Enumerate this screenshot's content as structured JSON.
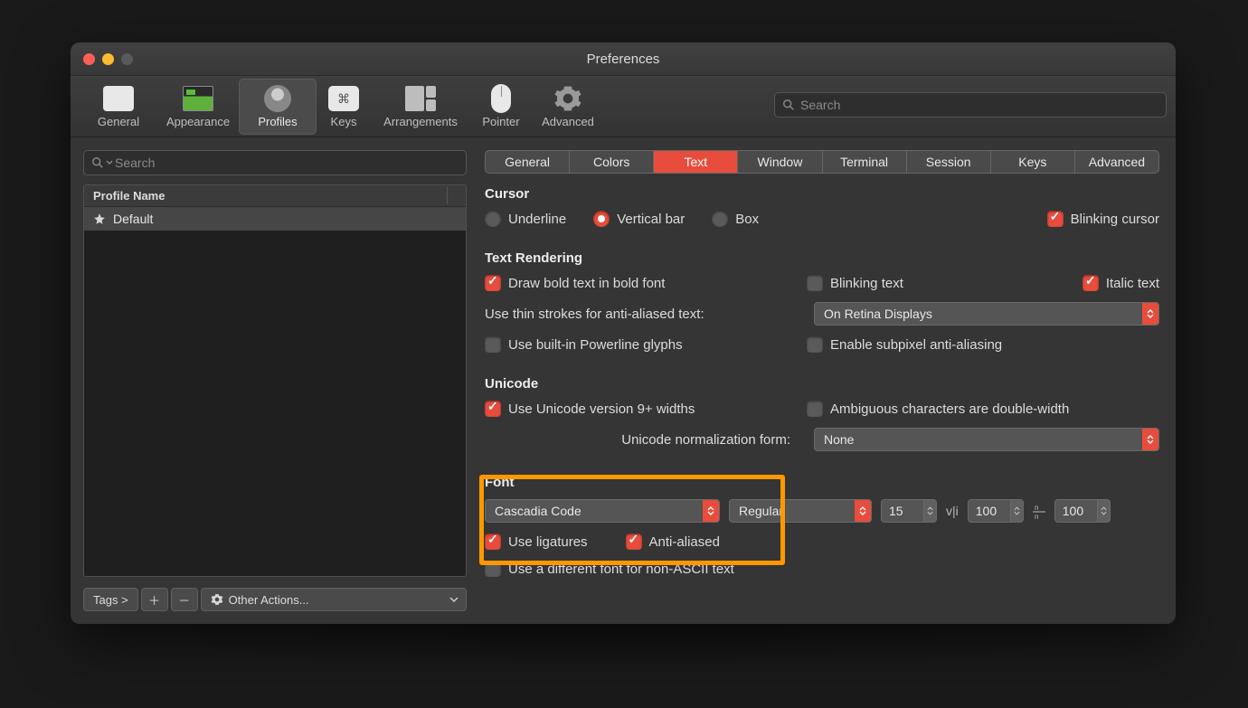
{
  "window": {
    "title": "Preferences"
  },
  "toolbar": {
    "items": [
      {
        "label": "General"
      },
      {
        "label": "Appearance"
      },
      {
        "label": "Profiles"
      },
      {
        "label": "Keys"
      },
      {
        "label": "Arrangements"
      },
      {
        "label": "Pointer"
      },
      {
        "label": "Advanced"
      }
    ],
    "search_placeholder": "Search"
  },
  "sidebar": {
    "search_placeholder": "Search",
    "header": "Profile Name",
    "rows": [
      {
        "name": "Default",
        "starred": true
      }
    ],
    "bottom": {
      "tags": "Tags >",
      "other_actions": "Other Actions..."
    }
  },
  "tabs": [
    "General",
    "Colors",
    "Text",
    "Window",
    "Terminal",
    "Session",
    "Keys",
    "Advanced"
  ],
  "active_tab": "Text",
  "cursor": {
    "title": "Cursor",
    "underline": "Underline",
    "vertical_bar": "Vertical bar",
    "box": "Box",
    "blinking": "Blinking cursor"
  },
  "text_rendering": {
    "title": "Text Rendering",
    "bold_font": "Draw bold text in bold font",
    "blinking_text": "Blinking text",
    "italic_text": "Italic text",
    "thin_strokes_label": "Use thin strokes for anti-aliased text:",
    "thin_strokes_value": "On Retina Displays",
    "powerline": "Use built-in Powerline glyphs",
    "subpixel": "Enable subpixel anti-aliasing"
  },
  "unicode": {
    "title": "Unicode",
    "v9": "Use Unicode version 9+ widths",
    "ambiguous": "Ambiguous characters are double-width",
    "norm_label": "Unicode normalization form:",
    "norm_value": "None"
  },
  "font": {
    "title": "Font",
    "family": "Cascadia Code",
    "weight": "Regular",
    "size": "15",
    "hspace": "100",
    "vspace": "100",
    "ligatures": "Use ligatures",
    "antialiased": "Anti-aliased",
    "non_ascii": "Use a different font for non-ASCII text"
  }
}
